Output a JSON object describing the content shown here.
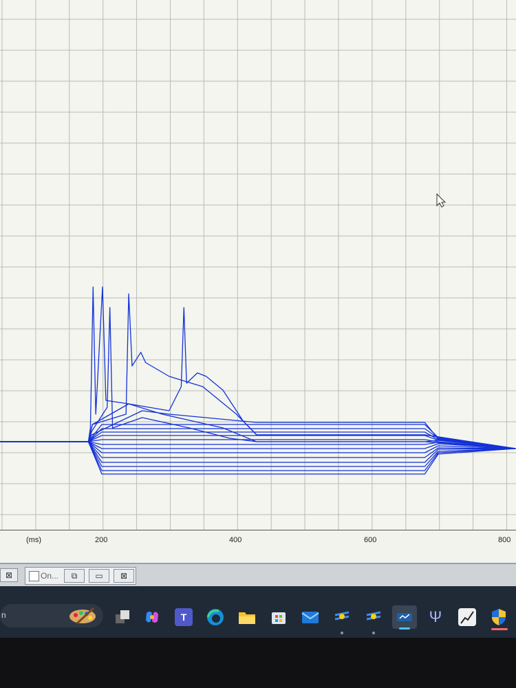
{
  "chart_data": {
    "type": "line",
    "xlabel": "(ms)",
    "ticks": [
      "200",
      "400",
      "600",
      "800"
    ],
    "xlim": [
      -100,
      815
    ],
    "step_start_ms": 180,
    "step_end_ms": 680,
    "series": [
      {
        "x": [
          -100,
          180,
          200,
          680,
          700,
          815
        ],
        "y": [
          0,
          0,
          -47,
          -47,
          -18,
          -10
        ]
      },
      {
        "x": [
          -100,
          180,
          200,
          680,
          700,
          815
        ],
        "y": [
          0,
          0,
          -42,
          -42,
          -16,
          -10
        ]
      },
      {
        "x": [
          -100,
          180,
          200,
          680,
          700,
          815
        ],
        "y": [
          0,
          0,
          -36,
          -36,
          -14,
          -10
        ]
      },
      {
        "x": [
          -100,
          180,
          200,
          680,
          700,
          815
        ],
        "y": [
          0,
          0,
          -30,
          -30,
          -11,
          -10
        ]
      },
      {
        "x": [
          -100,
          180,
          200,
          680,
          700,
          815
        ],
        "y": [
          0,
          0,
          -23,
          -23,
          -9,
          -10
        ]
      },
      {
        "x": [
          -100,
          180,
          200,
          680,
          700,
          815
        ],
        "y": [
          0,
          0,
          -16,
          -16,
          -6,
          -10
        ]
      },
      {
        "x": [
          -100,
          180,
          200,
          680,
          700,
          815
        ],
        "y": [
          0,
          0,
          -10,
          -10,
          -3,
          -10
        ]
      },
      {
        "x": [
          -100,
          180,
          200,
          680,
          700,
          815
        ],
        "y": [
          0,
          0,
          -4,
          -4,
          -1,
          -10
        ]
      },
      {
        "x": [
          -100,
          180,
          200,
          680,
          700,
          815
        ],
        "y": [
          0,
          0,
          3,
          3,
          0,
          -10
        ]
      },
      {
        "x": [
          -100,
          180,
          200,
          680,
          700,
          815
        ],
        "y": [
          0,
          0,
          9,
          9,
          2,
          -10
        ]
      },
      {
        "x": [
          -100,
          180,
          200,
          680,
          700,
          815
        ],
        "y": [
          0,
          0,
          14,
          14,
          3,
          -10
        ]
      },
      {
        "x": [
          -100,
          180,
          200,
          680,
          700,
          815
        ],
        "y": [
          0,
          0,
          19,
          19,
          5,
          -10
        ]
      },
      {
        "x": [
          -100,
          180,
          200,
          680,
          700,
          815
        ],
        "y": [
          0,
          0,
          25,
          25,
          6,
          -10
        ]
      },
      {
        "x": [
          -100,
          180,
          185,
          260,
          300,
          430,
          680,
          700,
          815
        ],
        "y": [
          0,
          0,
          10,
          45,
          40,
          28,
          28,
          4,
          -10
        ]
      },
      {
        "x": [
          -100,
          180,
          185,
          208,
          212,
          216,
          260,
          330,
          390,
          430,
          680,
          700,
          815
        ],
        "y": [
          0,
          0,
          15,
          50,
          195,
          20,
          35,
          20,
          5,
          0,
          0,
          2,
          -10
        ]
      },
      {
        "x": [
          -100,
          180,
          183,
          187,
          191,
          201,
          206,
          240,
          290,
          380,
          430,
          680,
          815
        ],
        "y": [
          0,
          0,
          20,
          225,
          40,
          225,
          60,
          55,
          40,
          20,
          0,
          0,
          -10
        ]
      },
      {
        "x": [
          -100,
          180,
          186,
          236,
          240,
          245,
          258,
          265,
          300,
          350,
          400,
          430,
          680,
          815
        ],
        "y": [
          0,
          0,
          25,
          40,
          215,
          110,
          130,
          115,
          95,
          80,
          40,
          10,
          10,
          -10
        ]
      },
      {
        "x": [
          -100,
          180,
          186,
          240,
          300,
          318,
          322,
          326,
          342,
          355,
          380,
          410,
          430,
          680,
          815
        ],
        "y": [
          0,
          0,
          25,
          55,
          45,
          80,
          195,
          85,
          100,
          95,
          75,
          30,
          10,
          10,
          -10
        ]
      }
    ]
  },
  "mdi": {
    "window_title": "On...",
    "close_glyph": "⊠",
    "restore_glyph": "⧉",
    "max_glyph": "▭"
  },
  "taskbar": {
    "search_text": "n",
    "apps": [
      "paint-palette",
      "task-view",
      "copilot",
      "teams",
      "edge",
      "file-explorer",
      "microsoft-store",
      "mail",
      "app-fly-1",
      "app-fly-2",
      "app-active",
      "psi-app",
      "chart-app",
      "security-shield"
    ]
  },
  "colors": {
    "trace": "#1432d8",
    "grid": "#b9bcb4",
    "plot_bg": "#f3f5ee"
  }
}
